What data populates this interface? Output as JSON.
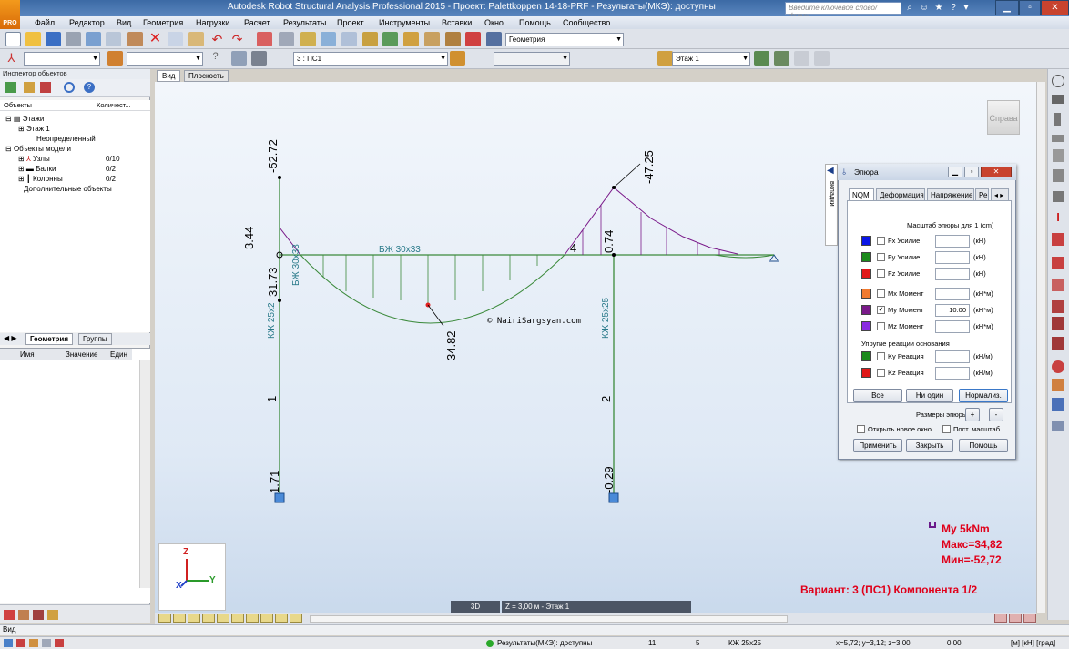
{
  "window": {
    "title": "Autodesk Robot Structural Analysis Professional 2015 - Проект: Palettkoppen 14-18-PRF - Результаты(МКЭ): доступны",
    "logo_text": "PRO",
    "search_placeholder": "Введите ключевое слово/фразу"
  },
  "menu": [
    "Файл",
    "Редактор",
    "Вид",
    "Геометрия",
    "Нагрузки",
    "Расчет",
    "Результаты",
    "Проект",
    "Инструменты",
    "Вставки",
    "Окно",
    "Помощь",
    "Сообщество"
  ],
  "toolbar": {
    "layout_combo": "Геометрия",
    "case_combo": "3 : ПС1",
    "story_combo": "Этаж 1"
  },
  "inspector": {
    "title": "Инспектор объектов",
    "col_objects": "Объекты",
    "col_count": "Количест...",
    "tree": [
      {
        "label": "Этажи",
        "count": ""
      },
      {
        "label": "Этаж 1",
        "count": ""
      },
      {
        "label": "Неопределенный",
        "count": ""
      },
      {
        "label": "Объекты модели",
        "count": ""
      },
      {
        "label": "Узлы",
        "count": "0/10"
      },
      {
        "label": "Балки",
        "count": "0/2"
      },
      {
        "label": "Колонны",
        "count": "0/2"
      },
      {
        "label": "Дополнительные объекты",
        "count": ""
      }
    ],
    "tabs": [
      "Геометрия",
      "Группы"
    ],
    "props_cols": [
      "Имя",
      "Значение",
      "Един"
    ]
  },
  "view": {
    "tabs": [
      "Вид",
      "Плоскость"
    ],
    "view_cube_label": "Справа",
    "side_tab": "вкладки",
    "watermark": "© NairiSargsyan.com",
    "mode_3d": "3D",
    "level_label": "Z = 3,00 м - Этаж 1",
    "axis_x": "X",
    "axis_y": "Y",
    "axis_z": "Z"
  },
  "diagram": {
    "beam_label": "БЖ 30x33",
    "col1_top_label": "БЖ 30x33",
    "col1_label": "КЖ 25x2",
    "col2_label": "КЖ 25x25",
    "member1": "1",
    "member2": "2",
    "member4": "4",
    "values": {
      "v_52_72": "-52.72",
      "v_3_44": "3.44",
      "v_31_73": "31.73",
      "v_34_82": "34.82",
      "v_47_25": "-47.25",
      "v_0_74": "0.74",
      "v_1_71": "1.71",
      "v_0_29": "-0.29"
    }
  },
  "result_info": {
    "legend": "My  5kNm",
    "max": "Макс=34,82",
    "min": "Мин=-52,72",
    "variant": "Вариант: 3 (ПС1) Компонента 1/2"
  },
  "dialog": {
    "title": "Эпюра",
    "tabs": [
      "NQM",
      "Деформация",
      "Напряжение",
      "Ре"
    ],
    "scale_label": "Масштаб эпюры для 1  (cm)",
    "rows": [
      {
        "color": "#0a16e8",
        "label": "Fx Усилие",
        "value": "",
        "unit": "(кН)",
        "checked": false
      },
      {
        "color": "#1c8a1c",
        "label": "Fy Усилие",
        "value": "",
        "unit": "(кН)",
        "checked": false
      },
      {
        "color": "#e01818",
        "label": "Fz Усилие",
        "value": "",
        "unit": "(кН)",
        "checked": false
      },
      {
        "color": "#f07a30",
        "label": "Mx Момент",
        "value": "",
        "unit": "(кН*м)",
        "checked": false
      },
      {
        "color": "#7a1a8a",
        "label": "My Момент",
        "value": "10.00",
        "unit": "(кН*м)",
        "checked": true
      },
      {
        "color": "#8a2be2",
        "label": "Mz Момент",
        "value": "",
        "unit": "(кН*м)",
        "checked": false
      }
    ],
    "elastic_label": "Упругие реакции основания",
    "elastic_rows": [
      {
        "color": "#1c8a1c",
        "label": "Ky Реакция",
        "value": "",
        "unit": "(кН/м)",
        "checked": false
      },
      {
        "color": "#e01818",
        "label": "Kz Реакция",
        "value": "",
        "unit": "(кН/м)",
        "checked": false
      }
    ],
    "btn_all": "Все",
    "btn_none": "Ни один",
    "btn_normalize": "Нормализ.",
    "sizes_label": "Размеры эпюры:",
    "plus": "+",
    "minus": "-",
    "open_new": "Открыть новое окно",
    "const_scale": "Пост. масштаб",
    "btn_apply": "Применить",
    "btn_close": "Закрыть",
    "btn_help": "Помощь"
  },
  "status": {
    "label": "Вид",
    "results": "Результаты(МКЭ): доступны",
    "n1": "11",
    "n2": "5",
    "section": "КЖ 25x25",
    "coords": "x=5,72; y=3,12; z=3,00",
    "coord2": "0,00",
    "units": "[м] [кН] [град]"
  }
}
